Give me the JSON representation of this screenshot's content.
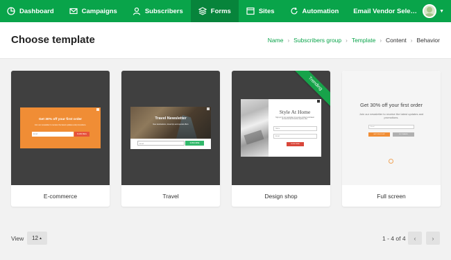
{
  "nav": {
    "items": [
      {
        "label": "Dashboard",
        "icon": "dashboard-icon"
      },
      {
        "label": "Campaigns",
        "icon": "envelope-icon"
      },
      {
        "label": "Subscribers",
        "icon": "user-icon"
      },
      {
        "label": "Forms",
        "icon": "layers-icon",
        "active": true
      },
      {
        "label": "Sites",
        "icon": "browser-icon"
      },
      {
        "label": "Automation",
        "icon": "refresh-icon"
      }
    ],
    "account_label": "Email Vendor Sele…",
    "brand_color": "#09a44a"
  },
  "header": {
    "title": "Choose template",
    "breadcrumb": [
      "Name",
      "Subscribers group",
      "Template",
      "Content",
      "Behavior"
    ]
  },
  "templates": [
    {
      "label": "E-commerce",
      "preview": {
        "heading": "Get 30% off your first order",
        "text": "Join our newsletter to receive the latest updates and promotions.",
        "input": "Email",
        "button": "CLAIM DEAL"
      }
    },
    {
      "label": "Travel",
      "preview": {
        "heading": "Travel Newsletter",
        "text": "New destinations, travel tips and special offers",
        "input": "Email",
        "button": "SUBSCRIBE"
      }
    },
    {
      "label": "Design shop",
      "badge": "Trending",
      "preview": {
        "heading": "Style At Home",
        "text": "Sign up for our newsletter to receive product and latest announcements before anyone else.",
        "input1": "Name",
        "input2": "Email",
        "button": "SUBSCRIBE"
      }
    },
    {
      "label": "Full screen",
      "preview": {
        "heading": "Get 30% off your first order",
        "text": "Join our newsletter to receive the latest updates and promotions.",
        "input": "Email",
        "button1": "GET DISCOUNT",
        "button2": "NO THANKS"
      }
    }
  ],
  "footer": {
    "view_label": "View",
    "page_size": "12",
    "range": "1 - 4 of 4",
    "prev": "‹",
    "next": "›"
  }
}
